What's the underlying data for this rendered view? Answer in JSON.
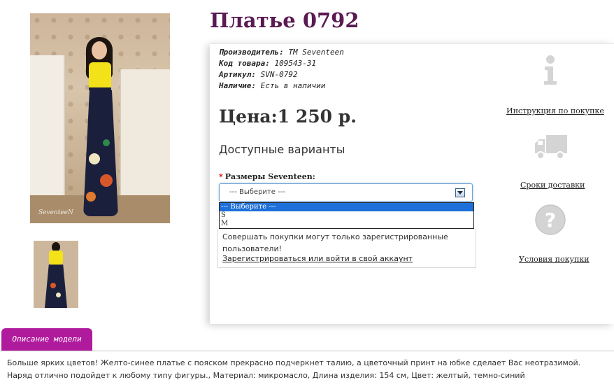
{
  "product": {
    "title": "Платье 0792",
    "specs": [
      {
        "label": "Производитель:",
        "value": "TM Seventeen"
      },
      {
        "label": "Код товара:",
        "value": "109543-31"
      },
      {
        "label": "Артикул:",
        "value": "SVN-0792"
      },
      {
        "label": "Наличие:",
        "value": "Есть в наличии"
      }
    ],
    "price": "Цена:1 250 р.",
    "variants_heading": "Доступные варианты",
    "size_label_required": "*",
    "size_label": "Размеры Seventeen:",
    "size_select_value": "--- Выберите ---",
    "size_options": [
      "--- Выберите ---",
      "S",
      "M"
    ],
    "notice_text": "Совершать покупки могут только зарегистрированные пользователи!",
    "notice_link": "Зарегистрироваться или войти в свой аккаунт",
    "image_signature": "SeventeeN"
  },
  "sidebar": {
    "links": [
      {
        "icon": "info-icon",
        "label": "Инструкция по покупке"
      },
      {
        "icon": "truck-icon",
        "label": "Сроки доставки"
      },
      {
        "icon": "question-icon",
        "label": "Условия покупки"
      }
    ]
  },
  "description": {
    "tab_label": "Описание модели",
    "text": "Больше ярких цветов! Желто-синее платье с пояском прекрасно подчеркнет талию, а цветочный принт на юбке сделает Вас неотразимой. Наряд отлично подойдет к любому типу фигуры., Материал: микромасло, Длина изделия: 154 см, Цвет: желтый, темно-синий"
  },
  "colors": {
    "title": "#5a1a52",
    "tab": "#b01a9c",
    "select_highlight": "#1e6fd9",
    "icon_gray": "#d4d4d4"
  }
}
